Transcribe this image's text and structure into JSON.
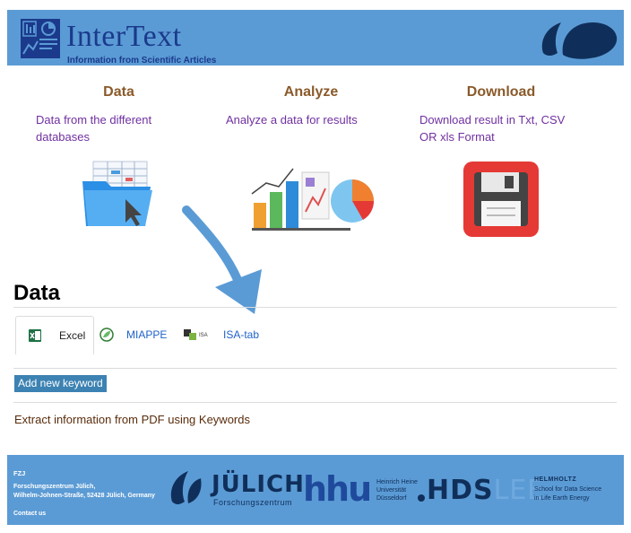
{
  "header": {
    "title": "InterText",
    "subtitle": "Information from Scientific Articles"
  },
  "features": [
    {
      "title": "Data",
      "description": "Data from the different databases",
      "icon": "folder-icon"
    },
    {
      "title": "Analyze",
      "description": "Analyze a data for results",
      "icon": "chart-icon"
    },
    {
      "title": "Download",
      "description": "Download result in Txt, CSV OR xls Format",
      "icon": "floppy-disk-icon"
    }
  ],
  "section": {
    "title": "Data"
  },
  "tabs": [
    {
      "label": "Excel",
      "icon": "excel-icon",
      "active": true
    },
    {
      "label": "MIAPPE",
      "icon": "miappe-icon",
      "active": false
    },
    {
      "label": "ISA-tab",
      "icon": "isa-icon",
      "active": false,
      "icon_text": "ISA"
    }
  ],
  "actions": {
    "add_keyword": "Add new keyword"
  },
  "extract_text": "Extract information from PDF using Keywords",
  "footer": {
    "org": "FZJ",
    "address_line1": "Forschungszentrum Jülich,",
    "address_line2": "Wilhelm-Johnen-Straße, 52428 Jülich, Germany",
    "contact": "Contact us",
    "juelich_name": "JÜLICH",
    "juelich_sub": "Forschungszentrum",
    "hhu": "hhu",
    "hhu_line1": "Heinrich Heine",
    "hhu_line2": "Universität",
    "hhu_line3": "Düsseldorf",
    "hds": "HDS",
    "lee": "LEE",
    "helmholtz": "HELMHOLTZ",
    "helmholtz_line1": "School for Data Science",
    "helmholtz_line2": "in Life Earth Energy"
  },
  "colors": {
    "header_bg": "#5b9bd5",
    "brand": "#1b3a8c",
    "feature_title": "#8a5a2a",
    "feature_text": "#7030a0",
    "tab_link": "#1e62c8",
    "button_bg": "#3c82b2",
    "arrow": "#5b9bd5"
  }
}
